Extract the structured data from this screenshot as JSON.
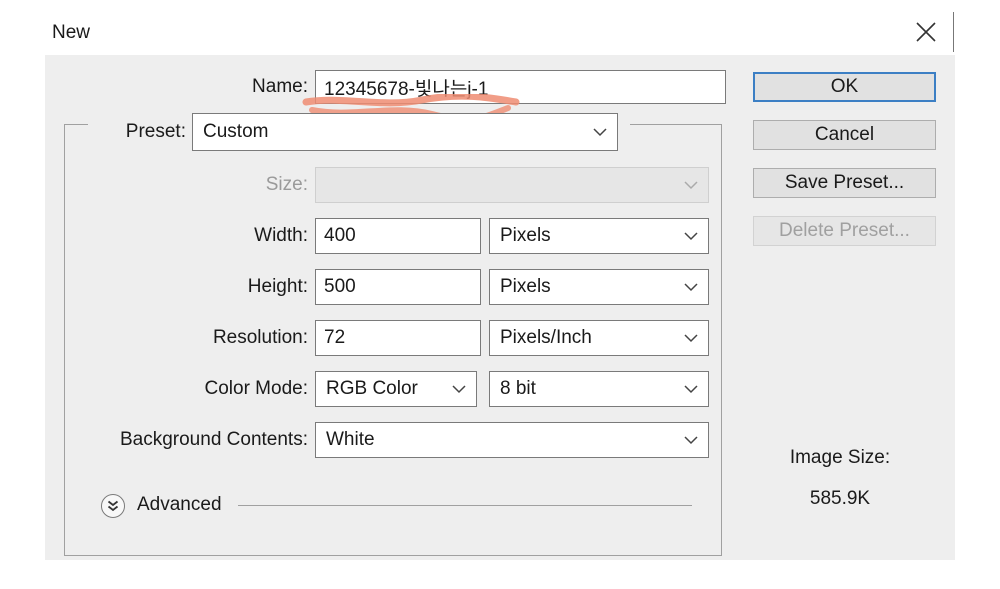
{
  "dialog": {
    "title": "New",
    "name_label": "Name:",
    "name_value": "12345678-빛나는j-1",
    "preset_label": "Preset:",
    "preset_value": "Custom",
    "size_label": "Size:",
    "size_value": "",
    "width_label": "Width:",
    "width_value": "400",
    "width_unit": "Pixels",
    "height_label": "Height:",
    "height_value": "500",
    "height_unit": "Pixels",
    "resolution_label": "Resolution:",
    "resolution_value": "72",
    "resolution_unit": "Pixels/Inch",
    "color_mode_label": "Color Mode:",
    "color_mode_value": "RGB Color",
    "bit_depth_value": "8 bit",
    "background_label": "Background Contents:",
    "background_value": "White",
    "advanced_label": "Advanced",
    "image_size_label": "Image Size:",
    "image_size_value": "585.9K"
  },
  "buttons": {
    "ok": "OK",
    "cancel": "Cancel",
    "save_preset": "Save Preset...",
    "delete_preset": "Delete Preset..."
  },
  "colors": {
    "panel_bg": "#eeeeee",
    "primary_border": "#3c7fc4",
    "redaction_scribble": "#ef8c72"
  },
  "icons": [
    "close-icon",
    "chevron-down-icon",
    "expand-advanced-icon"
  ]
}
